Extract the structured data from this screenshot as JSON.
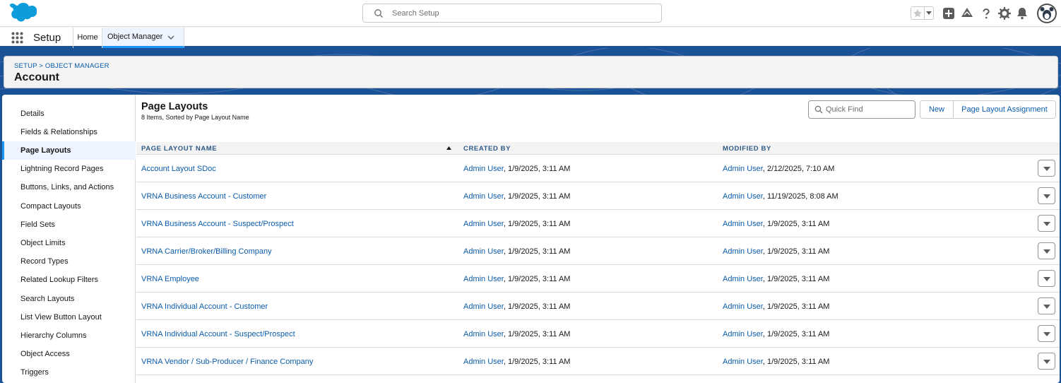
{
  "global_header": {
    "search_placeholder": "Search Setup",
    "icons": [
      "salesforce-logo",
      "favorites-star-icon",
      "favorites-dropdown-icon",
      "global-actions-icon",
      "trailhead-icon",
      "help-icon",
      "setup-gear-icon",
      "notifications-bell-icon",
      "user-avatar"
    ]
  },
  "context_bar": {
    "app_name": "Setup",
    "tabs": [
      {
        "label": "Home"
      },
      {
        "label": "Object Manager"
      }
    ]
  },
  "object_header": {
    "breadcrumb": "SETUP > OBJECT MANAGER",
    "title": "Account"
  },
  "sidebar": {
    "items": [
      {
        "label": "Details"
      },
      {
        "label": "Fields & Relationships"
      },
      {
        "label": "Page Layouts"
      },
      {
        "label": "Lightning Record Pages"
      },
      {
        "label": "Buttons, Links, and Actions"
      },
      {
        "label": "Compact Layouts"
      },
      {
        "label": "Field Sets"
      },
      {
        "label": "Object Limits"
      },
      {
        "label": "Record Types"
      },
      {
        "label": "Related Lookup Filters"
      },
      {
        "label": "Search Layouts"
      },
      {
        "label": "List View Button Layout"
      },
      {
        "label": "Hierarchy Columns"
      },
      {
        "label": "Object Access"
      },
      {
        "label": "Triggers"
      }
    ],
    "active": "Page Layouts"
  },
  "content": {
    "title": "Page Layouts",
    "subtitle": "8 Items, Sorted by Page Layout Name",
    "quick_find_placeholder": "Quick Find",
    "new_button": "New",
    "assignment_button": "Page Layout Assignment",
    "columns": [
      "PAGE LAYOUT NAME",
      "CREATED BY",
      "MODIFIED BY"
    ],
    "rows": [
      {
        "name": "Account Layout SDoc",
        "created_user": "Admin User",
        "created_date": ", 1/9/2025, 3:11 AM",
        "modified_user": "Admin User",
        "modified_date": ", 2/12/2025, 7:10 AM"
      },
      {
        "name": "VRNA Business Account - Customer",
        "created_user": "Admin User",
        "created_date": ", 1/9/2025, 3:11 AM",
        "modified_user": "Admin User",
        "modified_date": ", 11/19/2025, 8:08 AM"
      },
      {
        "name": "VRNA Business Account - Suspect/Prospect",
        "created_user": "Admin User",
        "created_date": ", 1/9/2025, 3:11 AM",
        "modified_user": "Admin User",
        "modified_date": ", 1/9/2025, 3:11 AM"
      },
      {
        "name": "VRNA Carrier/Broker/Billing Company",
        "created_user": "Admin User",
        "created_date": ", 1/9/2025, 3:11 AM",
        "modified_user": "Admin User",
        "modified_date": ", 1/9/2025, 3:11 AM"
      },
      {
        "name": "VRNA Employee",
        "created_user": "Admin User",
        "created_date": ", 1/9/2025, 3:11 AM",
        "modified_user": "Admin User",
        "modified_date": ", 1/9/2025, 3:11 AM"
      },
      {
        "name": "VRNA Individual Account - Customer",
        "created_user": "Admin User",
        "created_date": ", 1/9/2025, 3:11 AM",
        "modified_user": "Admin User",
        "modified_date": ", 1/9/2025, 3:11 AM"
      },
      {
        "name": "VRNA Individual Account - Suspect/Prospect",
        "created_user": "Admin User",
        "created_date": ", 1/9/2025, 3:11 AM",
        "modified_user": "Admin User",
        "modified_date": ", 1/9/2025, 3:11 AM"
      },
      {
        "name": "VRNA Vendor / Sub-Producer / Finance Company",
        "created_user": "Admin User",
        "created_date": ", 1/9/2025, 3:11 AM",
        "modified_user": "Admin User",
        "modified_date": ", 1/9/2025, 3:11 AM"
      }
    ]
  },
  "colors": {
    "brand_blue": "#1b5297",
    "link_blue": "#0b5cab",
    "active_indicator": "#1b96ff",
    "logo_blue": "#0d9dda"
  }
}
